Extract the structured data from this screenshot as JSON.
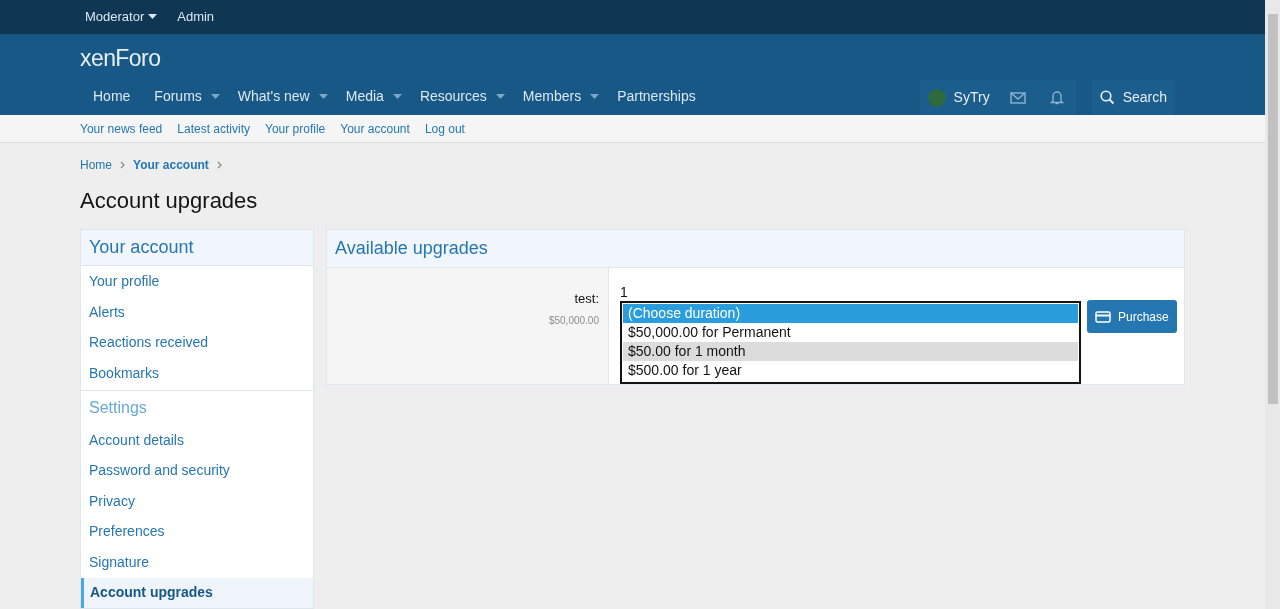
{
  "staff_bar": [
    {
      "label": "Moderator",
      "has_menu": true
    },
    {
      "label": "Admin",
      "has_menu": false
    }
  ],
  "logo": {
    "text": "xenForo"
  },
  "nav_tabs": [
    {
      "label": "Home",
      "has_menu": false
    },
    {
      "label": "Forums",
      "has_menu": true
    },
    {
      "label": "What's new",
      "has_menu": true
    },
    {
      "label": "Media",
      "has_menu": true
    },
    {
      "label": "Resources",
      "has_menu": true
    },
    {
      "label": "Members",
      "has_menu": true
    },
    {
      "label": "Partnerships",
      "has_menu": false
    }
  ],
  "user_nav": {
    "username": "SyTry",
    "search_label": "Search"
  },
  "sub_nav": [
    "Your news feed",
    "Latest activity",
    "Your profile",
    "Your account",
    "Log out"
  ],
  "breadcrumbs": [
    {
      "label": "Home",
      "bold": false
    },
    {
      "label": "Your account",
      "bold": true
    }
  ],
  "page_title": "Account upgrades",
  "sidebar": {
    "sections": [
      {
        "title": "Your account",
        "kind": "primary",
        "items": [
          {
            "label": "Your profile",
            "selected": false
          },
          {
            "label": "Alerts",
            "selected": false
          },
          {
            "label": "Reactions received",
            "selected": false
          },
          {
            "label": "Bookmarks",
            "selected": false
          }
        ]
      },
      {
        "title": "Settings",
        "kind": "secondary",
        "items": [
          {
            "label": "Account details",
            "selected": false
          },
          {
            "label": "Password and security",
            "selected": false
          },
          {
            "label": "Privacy",
            "selected": false
          },
          {
            "label": "Preferences",
            "selected": false
          },
          {
            "label": "Signature",
            "selected": false
          },
          {
            "label": "Account upgrades",
            "selected": true
          }
        ]
      }
    ]
  },
  "upgrades": {
    "title": "Available upgrades",
    "rows": [
      {
        "label": "test:",
        "price": "$50,000.00",
        "field_value": "1",
        "options": [
          {
            "label": "(Choose duration)",
            "selected": true,
            "hovered": false
          },
          {
            "label": "$50,000.00 for Permanent",
            "selected": false,
            "hovered": false
          },
          {
            "label": "$50.00 for 1 month",
            "selected": false,
            "hovered": true
          },
          {
            "label": "$500.00 for 1 year",
            "selected": false,
            "hovered": false
          }
        ],
        "button": "Purchase"
      }
    ]
  }
}
